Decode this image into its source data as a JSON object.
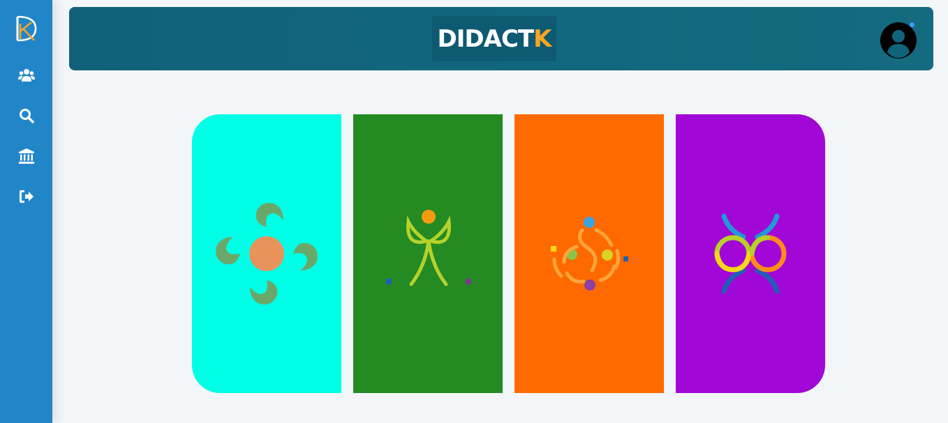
{
  "brand": {
    "text_main": "DIDACT",
    "text_accent": "K"
  },
  "colors": {
    "sidebar": "#2186c8",
    "topbar": "#11637c",
    "background": "#f3f6f9",
    "card_1": "#00ffe7",
    "card_2": "#248a22",
    "card_3": "#ff6a00",
    "card_4": "#a107d6"
  },
  "sidebar": {
    "items": [
      {
        "icon": "users-icon"
      },
      {
        "icon": "search-icon"
      },
      {
        "icon": "bank-icon"
      },
      {
        "icon": "logout-icon"
      }
    ]
  },
  "header": {
    "avatar_icon": "user-circle-icon",
    "notification": true
  },
  "cards": [
    {
      "icon": "swirl-emblem-icon",
      "color": "#00ffe7"
    },
    {
      "icon": "leaf-figure-emblem-icon",
      "color": "#248a22"
    },
    {
      "icon": "dancing-figures-emblem-icon",
      "color": "#ff6a00"
    },
    {
      "icon": "rings-emblem-icon",
      "color": "#a107d6"
    }
  ]
}
